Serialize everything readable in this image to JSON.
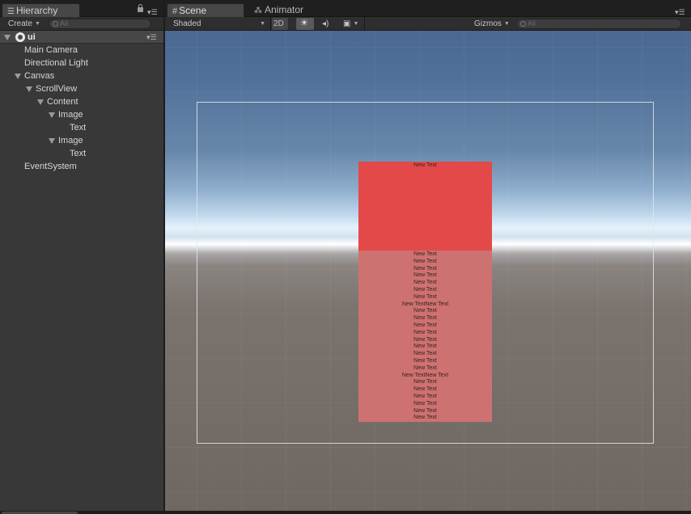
{
  "hierarchy": {
    "tab_title": "Hierarchy",
    "create_label": "Create",
    "search_placeholder": "All",
    "scene_name": "ui",
    "items": [
      {
        "label": "Main Camera"
      },
      {
        "label": "Directional Light"
      },
      {
        "label": "Canvas"
      },
      {
        "label": "ScrollView"
      },
      {
        "label": "Content"
      },
      {
        "label": "Image"
      },
      {
        "label": "Text"
      },
      {
        "label": "Image"
      },
      {
        "label": "Text"
      },
      {
        "label": "EventSystem"
      }
    ]
  },
  "scene": {
    "tab_title": "Scene",
    "animator_tab": "Animator",
    "shading_mode": "Shaded",
    "mode_2d": "2D",
    "gizmos_label": "Gizmos",
    "search_placeholder": "All",
    "image1_text": "New Text",
    "image2_lines": [
      "New Text",
      "New Text",
      "New Text",
      "New Text",
      "New Text",
      "New Text",
      "New Text",
      "New TextNew Text",
      "New Text",
      "New Text",
      "New Text",
      "New Text",
      "New Text",
      "New Text",
      "New Text",
      "New Text",
      "New Text",
      "New TextNew Text",
      "New Text",
      "New Text",
      "New Text",
      "New Text",
      "New Text",
      "New Text"
    ]
  },
  "icons": {
    "hierarchy_tab": "list-icon",
    "scene_tab": "grid-icon",
    "animator_tab": "animator-icon",
    "lighting": "sun-icon",
    "audio": "speaker-icon",
    "effects": "image-icon"
  },
  "colors": {
    "image1": "#e34948",
    "image2": "#cd7271",
    "panel": "#383838"
  }
}
